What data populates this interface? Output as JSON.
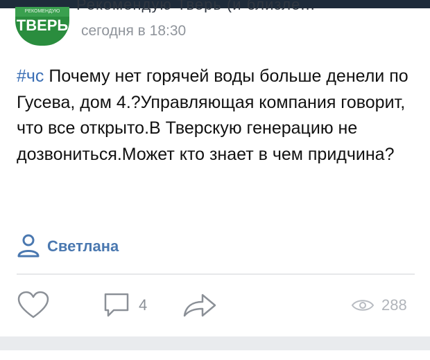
{
  "header": {
    "title_partial": "Рекомендую Тверь (и близле..."
  },
  "post": {
    "avatar_text": "ТВЕРЬ",
    "avatar_top_text": "РЕКОМЕНДУЮ",
    "timestamp": "сегодня в 18:30",
    "hashtag": "#чс",
    "text": " Почему нет горячей воды больше денели по Гусева, дом 4.?Управляющая компания говорит, что все открыто.В Тверскую генерацию не дозвониться.Может кто знает в чем придчина?",
    "author": "Светлана"
  },
  "actions": {
    "comments_count": "4",
    "views_count": "288"
  },
  "icons": {
    "author": "person-icon",
    "like": "heart-icon",
    "comment": "comment-icon",
    "share": "share-icon",
    "views": "eye-icon"
  },
  "colors": {
    "accent": "#4a78b0",
    "hashtag": "#3b6fb5",
    "muted": "#8b9097",
    "avatar_green": "#2a8d3e"
  }
}
